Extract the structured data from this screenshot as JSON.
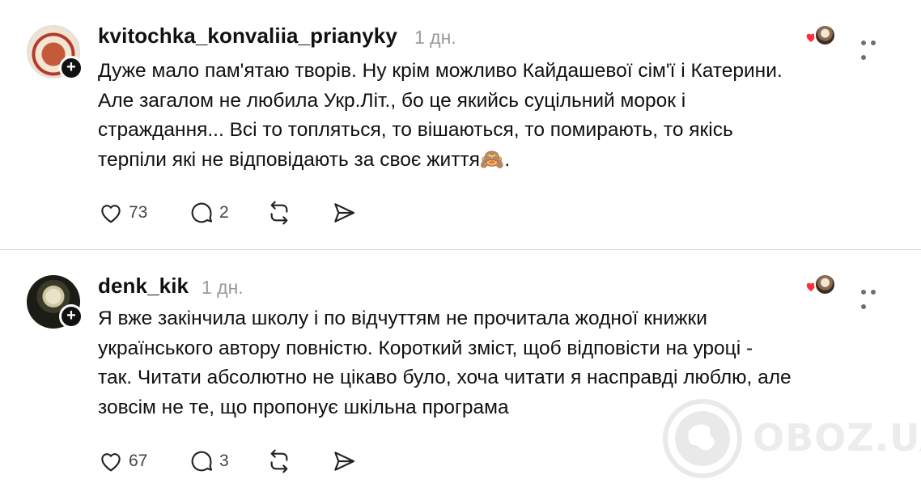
{
  "posts": [
    {
      "username": "kvitochka_konvaliia_prianyky",
      "time": "1 дн.",
      "text": "Дуже мало пам'ятаю творів. Ну крім можливо Кайдашевої сім'ї і Катерини.\nАле загалом не любила Укр.Літ., бо це якийсь суцільний морок і\nстраждання... Всі то топляться, то вішаються, то помирають, то якісь\nтерпіли які не відповідають за своє життя🙈.",
      "likes": "73",
      "replies": "2"
    },
    {
      "username": "denk_kik",
      "time": "1 дн.",
      "text": "Я вже закінчила школу і по відчуттям не прочитала жодної книжки\nукраїнського автору повністю. Короткий зміст, щоб відповісти на уроці -\nтак. Читати абсолютно не цікаво було, хоча читати я насправді люблю, але\nзовсім не те, що пропонує шкільна програма",
      "likes": "67",
      "replies": "3"
    }
  ],
  "watermark": {
    "text": "OBOZ.UA"
  },
  "icons": {
    "like": "heart-icon",
    "reply": "comment-icon",
    "repost": "repost-icon",
    "share": "send-icon",
    "more": "more-dots-icon",
    "follow": "plus-icon"
  },
  "colors": {
    "text": "#111111",
    "muted": "#9a9a9a",
    "divider": "#d8d8d8",
    "heart": "#ff3040"
  }
}
